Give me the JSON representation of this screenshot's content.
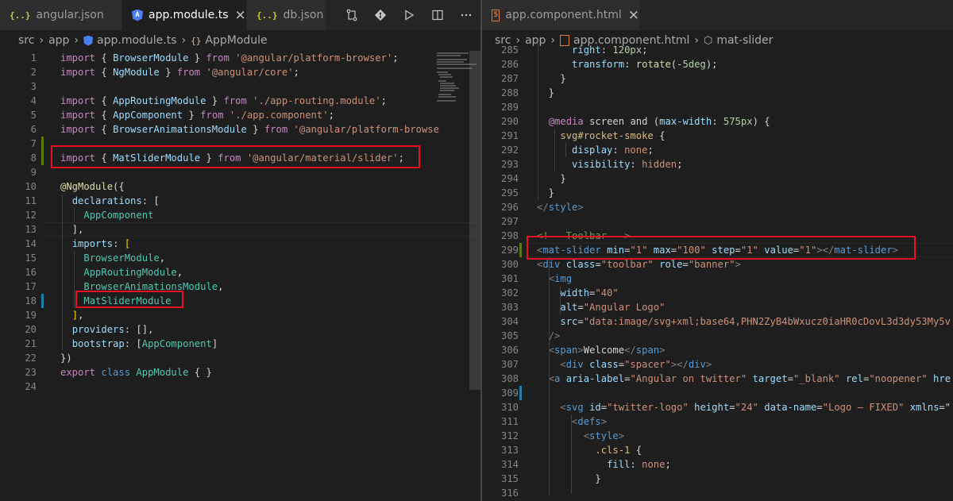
{
  "left": {
    "tabs": [
      {
        "label": "angular.json",
        "icon": "json-icon",
        "active": false
      },
      {
        "label": "app.module.ts",
        "icon": "angular-icon",
        "active": true
      },
      {
        "label": "db.json",
        "icon": "json-icon",
        "active": false
      }
    ],
    "close_glyph": "×",
    "breadcrumb": [
      "src",
      "app",
      "app.module.ts",
      "AppModule"
    ],
    "lines": [
      {
        "n": "1",
        "t": [
          [
            "kw",
            "import "
          ],
          [
            "pu",
            "{ "
          ],
          [
            "vr",
            "BrowserModule"
          ],
          [
            "pu",
            " } "
          ],
          [
            "kw",
            "from "
          ],
          [
            "st",
            "'@angular/platform-browser'"
          ],
          [
            "pu",
            ";"
          ]
        ]
      },
      {
        "n": "2",
        "t": [
          [
            "kw",
            "import "
          ],
          [
            "pu",
            "{ "
          ],
          [
            "vr",
            "NgModule"
          ],
          [
            "pu",
            " } "
          ],
          [
            "kw",
            "from "
          ],
          [
            "st",
            "'@angular/core'"
          ],
          [
            "pu",
            ";"
          ]
        ]
      },
      {
        "n": "3",
        "t": []
      },
      {
        "n": "4",
        "t": [
          [
            "kw",
            "import "
          ],
          [
            "pu",
            "{ "
          ],
          [
            "vr",
            "AppRoutingModule"
          ],
          [
            "pu",
            " } "
          ],
          [
            "kw",
            "from "
          ],
          [
            "st",
            "'./app-routing.module'"
          ],
          [
            "pu",
            ";"
          ]
        ]
      },
      {
        "n": "5",
        "t": [
          [
            "kw",
            "import "
          ],
          [
            "pu",
            "{ "
          ],
          [
            "vr",
            "AppComponent"
          ],
          [
            "pu",
            " } "
          ],
          [
            "kw",
            "from "
          ],
          [
            "st",
            "'./app.component'"
          ],
          [
            "pu",
            ";"
          ]
        ]
      },
      {
        "n": "6",
        "t": [
          [
            "kw",
            "import "
          ],
          [
            "pu",
            "{ "
          ],
          [
            "vr",
            "BrowserAnimationsModule"
          ],
          [
            "pu",
            " } "
          ],
          [
            "kw",
            "from "
          ],
          [
            "st",
            "'@angular/platform-browse"
          ]
        ]
      },
      {
        "n": "7",
        "t": []
      },
      {
        "n": "8",
        "t": [
          [
            "kw",
            "import "
          ],
          [
            "pu",
            "{ "
          ],
          [
            "vr",
            "MatSliderModule"
          ],
          [
            "pu",
            " } "
          ],
          [
            "kw",
            "from "
          ],
          [
            "st",
            "'@angular/material/slider'"
          ],
          [
            "pu",
            ";"
          ]
        ]
      },
      {
        "n": "9",
        "t": []
      },
      {
        "n": "10",
        "t": [
          [
            "fn",
            "@NgModule"
          ],
          [
            "pu",
            "({"
          ]
        ]
      },
      {
        "n": "11",
        "t": [
          [
            "pu",
            "  "
          ],
          [
            "vr",
            "declarations"
          ],
          [
            "pu",
            ": ["
          ]
        ]
      },
      {
        "n": "12",
        "t": [
          [
            "pu",
            "    "
          ],
          [
            "cl",
            "AppComponent"
          ]
        ]
      },
      {
        "n": "13",
        "t": [
          [
            "pu",
            "  ],"
          ]
        ]
      },
      {
        "n": "14",
        "t": [
          [
            "pu",
            "  "
          ],
          [
            "vr",
            "imports"
          ],
          [
            "pu",
            ": "
          ],
          [
            "bk",
            "["
          ]
        ]
      },
      {
        "n": "15",
        "t": [
          [
            "pu",
            "    "
          ],
          [
            "cl",
            "BrowserModule"
          ],
          [
            "pu",
            ","
          ]
        ]
      },
      {
        "n": "16",
        "t": [
          [
            "pu",
            "    "
          ],
          [
            "cl",
            "AppRoutingModule"
          ],
          [
            "pu",
            ","
          ]
        ]
      },
      {
        "n": "17",
        "t": [
          [
            "pu",
            "    "
          ],
          [
            "cl",
            "BrowserAnimationsModule"
          ],
          [
            "pu",
            ","
          ]
        ]
      },
      {
        "n": "18",
        "t": [
          [
            "pu",
            "    "
          ],
          [
            "cl",
            "MatSliderModule"
          ]
        ]
      },
      {
        "n": "19",
        "t": [
          [
            "pu",
            "  "
          ],
          [
            "bk",
            "]"
          ],
          [
            "pu",
            ","
          ]
        ]
      },
      {
        "n": "20",
        "t": [
          [
            "pu",
            "  "
          ],
          [
            "vr",
            "providers"
          ],
          [
            "pu",
            ": [],"
          ]
        ]
      },
      {
        "n": "21",
        "t": [
          [
            "pu",
            "  "
          ],
          [
            "vr",
            "bootstrap"
          ],
          [
            "pu",
            ": ["
          ],
          [
            "cl",
            "AppComponent"
          ],
          [
            "pu",
            "]"
          ]
        ]
      },
      {
        "n": "22",
        "t": [
          [
            "pu",
            "})"
          ]
        ]
      },
      {
        "n": "23",
        "t": [
          [
            "kw",
            "export "
          ],
          [
            "kb",
            "class "
          ],
          [
            "cl",
            "AppModule"
          ],
          [
            "pu",
            " { }"
          ]
        ]
      },
      {
        "n": "24",
        "t": []
      }
    ]
  },
  "right": {
    "tabs": [
      {
        "label": "app.component.html",
        "icon": "html5-icon",
        "active": false
      }
    ],
    "close_glyph": "×",
    "breadcrumb": [
      "src",
      "app",
      "app.component.html",
      "mat-slider"
    ],
    "lines": [
      {
        "n": "285",
        "t": [
          [
            "pu",
            "      "
          ],
          [
            "vr",
            "right"
          ],
          [
            "pu",
            ": "
          ],
          [
            "nm",
            "120px"
          ],
          [
            "pu",
            ";"
          ]
        ]
      },
      {
        "n": "286",
        "t": [
          [
            "pu",
            "      "
          ],
          [
            "vr",
            "transform"
          ],
          [
            "pu",
            ": "
          ],
          [
            "fn",
            "rotate"
          ],
          [
            "pu",
            "("
          ],
          [
            "nm",
            "-5deg"
          ],
          [
            "pu",
            ");"
          ]
        ]
      },
      {
        "n": "287",
        "t": [
          [
            "pu",
            "    }"
          ]
        ]
      },
      {
        "n": "288",
        "t": [
          [
            "pu",
            "  }"
          ]
        ]
      },
      {
        "n": "289",
        "t": []
      },
      {
        "n": "290",
        "t": [
          [
            "pu",
            "  "
          ],
          [
            "kw",
            "@media "
          ],
          [
            "pu",
            "screen "
          ],
          [
            "pu",
            "and "
          ],
          [
            "pu",
            "("
          ],
          [
            "vr",
            "max-width"
          ],
          [
            "pu",
            ": "
          ],
          [
            "nm",
            "575px"
          ],
          [
            "pu",
            ") {"
          ]
        ]
      },
      {
        "n": "291",
        "t": [
          [
            "pu",
            "    "
          ],
          [
            "sel",
            "svg#rocket-smoke"
          ],
          [
            "pu",
            " {"
          ]
        ]
      },
      {
        "n": "292",
        "t": [
          [
            "pu",
            "      "
          ],
          [
            "vr",
            "display"
          ],
          [
            "pu",
            ": "
          ],
          [
            "st",
            "none"
          ],
          [
            "pu",
            ";"
          ]
        ]
      },
      {
        "n": "293",
        "t": [
          [
            "pu",
            "      "
          ],
          [
            "vr",
            "visibility"
          ],
          [
            "pu",
            ": "
          ],
          [
            "st",
            "hidden"
          ],
          [
            "pu",
            ";"
          ]
        ]
      },
      {
        "n": "294",
        "t": [
          [
            "pu",
            "    }"
          ]
        ]
      },
      {
        "n": "295",
        "t": [
          [
            "pu",
            "  }"
          ]
        ]
      },
      {
        "n": "296",
        "t": [
          [
            "br",
            "</"
          ],
          [
            "tg",
            "style"
          ],
          [
            "br",
            ">"
          ]
        ]
      },
      {
        "n": "297",
        "t": []
      },
      {
        "n": "298",
        "t": [
          [
            "cm",
            "<!-- Toolbar -->"
          ]
        ]
      },
      {
        "n": "299",
        "t": [
          [
            "br",
            "<"
          ],
          [
            "tg",
            "mat-slider"
          ],
          [
            "pu",
            " "
          ],
          [
            "at",
            "min"
          ],
          [
            "pu",
            "="
          ],
          [
            "st",
            "\"1\""
          ],
          [
            "pu",
            " "
          ],
          [
            "at",
            "max"
          ],
          [
            "pu",
            "="
          ],
          [
            "st",
            "\"100\""
          ],
          [
            "pu",
            " "
          ],
          [
            "at",
            "step"
          ],
          [
            "pu",
            "="
          ],
          [
            "st",
            "\"1\""
          ],
          [
            "pu",
            " "
          ],
          [
            "at",
            "value"
          ],
          [
            "pu",
            "="
          ],
          [
            "st",
            "\"1\""
          ],
          [
            "br",
            "></"
          ],
          [
            "tg",
            "mat-slider"
          ],
          [
            "br",
            ">"
          ]
        ]
      },
      {
        "n": "300",
        "t": [
          [
            "br",
            "<"
          ],
          [
            "tg",
            "div"
          ],
          [
            "pu",
            " "
          ],
          [
            "at",
            "class"
          ],
          [
            "pu",
            "="
          ],
          [
            "st",
            "\"toolbar\""
          ],
          [
            "pu",
            " "
          ],
          [
            "at",
            "role"
          ],
          [
            "pu",
            "="
          ],
          [
            "st",
            "\"banner\""
          ],
          [
            "br",
            ">"
          ]
        ]
      },
      {
        "n": "301",
        "t": [
          [
            "pu",
            "  "
          ],
          [
            "br",
            "<"
          ],
          [
            "tg",
            "img"
          ]
        ]
      },
      {
        "n": "302",
        "t": [
          [
            "pu",
            "    "
          ],
          [
            "at",
            "width"
          ],
          [
            "pu",
            "="
          ],
          [
            "st",
            "\"40\""
          ]
        ]
      },
      {
        "n": "303",
        "t": [
          [
            "pu",
            "    "
          ],
          [
            "at",
            "alt"
          ],
          [
            "pu",
            "="
          ],
          [
            "st",
            "\"Angular Logo\""
          ]
        ]
      },
      {
        "n": "304",
        "t": [
          [
            "pu",
            "    "
          ],
          [
            "at",
            "src"
          ],
          [
            "pu",
            "="
          ],
          [
            "st",
            "\"data:image/svg+xml;base64,PHN2ZyB4bWxucz0iaHR0cDovL3d3dy53My5v"
          ]
        ]
      },
      {
        "n": "305",
        "t": [
          [
            "pu",
            "  "
          ],
          [
            "br",
            "/>"
          ]
        ]
      },
      {
        "n": "306",
        "t": [
          [
            "pu",
            "  "
          ],
          [
            "br",
            "<"
          ],
          [
            "tg",
            "span"
          ],
          [
            "br",
            ">"
          ],
          [
            "tx",
            "Welcome"
          ],
          [
            "br",
            "</"
          ],
          [
            "tg",
            "span"
          ],
          [
            "br",
            ">"
          ]
        ]
      },
      {
        "n": "307",
        "t": [
          [
            "pu",
            "    "
          ],
          [
            "br",
            "<"
          ],
          [
            "tg",
            "div"
          ],
          [
            "pu",
            " "
          ],
          [
            "at",
            "class"
          ],
          [
            "pu",
            "="
          ],
          [
            "st",
            "\"spacer\""
          ],
          [
            "br",
            "></"
          ],
          [
            "tg",
            "div"
          ],
          [
            "br",
            ">"
          ]
        ]
      },
      {
        "n": "308",
        "t": [
          [
            "pu",
            "  "
          ],
          [
            "br",
            "<"
          ],
          [
            "tg",
            "a"
          ],
          [
            "pu",
            " "
          ],
          [
            "at",
            "aria-label"
          ],
          [
            "pu",
            "="
          ],
          [
            "st",
            "\"Angular on twitter\""
          ],
          [
            "pu",
            " "
          ],
          [
            "at",
            "target"
          ],
          [
            "pu",
            "="
          ],
          [
            "st",
            "\"_blank\""
          ],
          [
            "pu",
            " "
          ],
          [
            "at",
            "rel"
          ],
          [
            "pu",
            "="
          ],
          [
            "st",
            "\"noopener\""
          ],
          [
            "pu",
            " "
          ],
          [
            "at",
            "hre"
          ]
        ]
      },
      {
        "n": "309",
        "t": []
      },
      {
        "n": "310",
        "t": [
          [
            "pu",
            "    "
          ],
          [
            "br",
            "<"
          ],
          [
            "tg",
            "svg"
          ],
          [
            "pu",
            " "
          ],
          [
            "at",
            "id"
          ],
          [
            "pu",
            "="
          ],
          [
            "st",
            "\"twitter-logo\""
          ],
          [
            "pu",
            " "
          ],
          [
            "at",
            "height"
          ],
          [
            "pu",
            "="
          ],
          [
            "st",
            "\"24\""
          ],
          [
            "pu",
            " "
          ],
          [
            "at",
            "data-name"
          ],
          [
            "pu",
            "="
          ],
          [
            "st",
            "\"Logo — FIXED\""
          ],
          [
            "pu",
            " "
          ],
          [
            "at",
            "xmlns"
          ],
          [
            "pu",
            "=\""
          ]
        ]
      },
      {
        "n": "311",
        "t": [
          [
            "pu",
            "      "
          ],
          [
            "br",
            "<"
          ],
          [
            "tg",
            "defs"
          ],
          [
            "br",
            ">"
          ]
        ]
      },
      {
        "n": "312",
        "t": [
          [
            "pu",
            "        "
          ],
          [
            "br",
            "<"
          ],
          [
            "tg",
            "style"
          ],
          [
            "br",
            ">"
          ]
        ]
      },
      {
        "n": "313",
        "t": [
          [
            "pu",
            "          "
          ],
          [
            "sel",
            ".cls-1"
          ],
          [
            "pu",
            " {"
          ]
        ]
      },
      {
        "n": "314",
        "t": [
          [
            "pu",
            "            "
          ],
          [
            "vr",
            "fill"
          ],
          [
            "pu",
            ": "
          ],
          [
            "st",
            "none"
          ],
          [
            "pu",
            ";"
          ]
        ]
      },
      {
        "n": "315",
        "t": [
          [
            "pu",
            "          }"
          ]
        ]
      },
      {
        "n": "316",
        "t": []
      }
    ]
  },
  "colors": {
    "highlight_box": "#e81123",
    "active_tab_bg": "#1e1e1e",
    "editor_bg": "#1e1e1e"
  }
}
